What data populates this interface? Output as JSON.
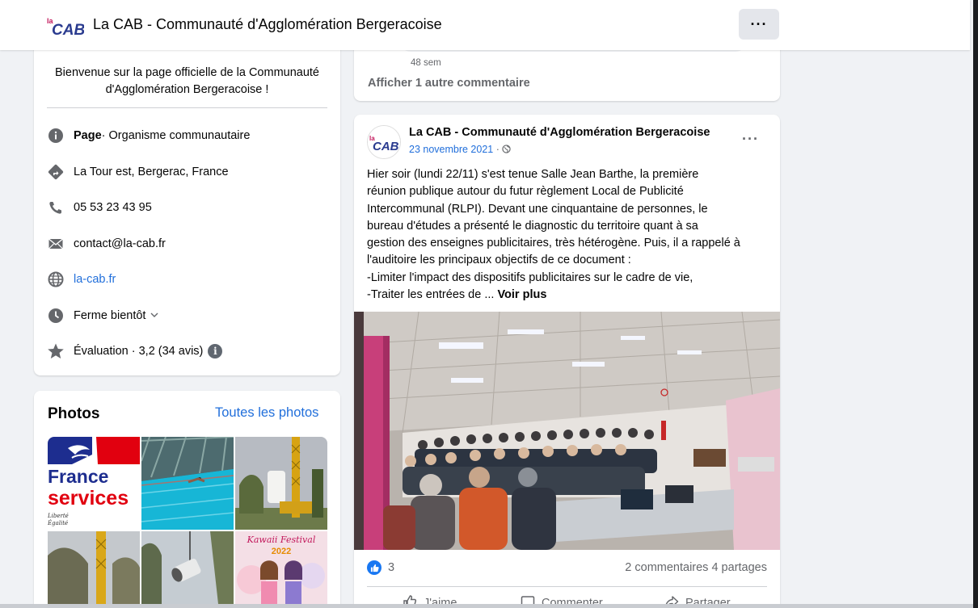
{
  "header": {
    "logo_text": "laCAB",
    "title": "La CAB - Communauté d'Agglomération Bergeracoise",
    "more_label": "···"
  },
  "intro": {
    "welcome": "Bienvenue sur la page officielle de la Communauté d'Agglomération Bergeracoise !",
    "category_label": "Page",
    "category_value": " · Organisme communautaire",
    "address": "La Tour est, Bergerac, France",
    "phone": "05 53 23 43 95",
    "email": "contact@la-cab.fr",
    "website": "la-cab.fr",
    "hours": "Ferme bientôt",
    "rating": "Évaluation · 3,2 (34 avis)",
    "icons": [
      "info-icon",
      "location-icon",
      "phone-icon",
      "email-icon",
      "globe-icon",
      "clock-icon",
      "star-icon"
    ]
  },
  "photos": {
    "title": "Photos",
    "see_all": "Toutes les photos",
    "france_services": {
      "line1": "France",
      "line2": "services",
      "motto1": "Liberté",
      "motto2": "Égalité"
    },
    "festival": {
      "title": "Kawaii Festival",
      "year": "2022"
    }
  },
  "comment": {
    "time": "48 sem",
    "more": "Afficher 1 autre commentaire"
  },
  "post": {
    "author": "La CAB - Communauté d'Agglomération Bergeracoise",
    "date": "23 novembre 2021",
    "date_sep": " · ",
    "lines": [
      "Hier soir (lundi 22/11) s'est tenue Salle Jean Barthe, la première",
      "réunion publique autour du futur règlement Local de Publicité",
      "Intercommunal (RLPI). Devant une cinquantaine de personnes, le",
      "bureau d'études a présenté le diagnostic du territoire quant à sa",
      "gestion des enseignes publicitaires, très hétérogène. Puis, il a rappelé à",
      "l'auditoire les principaux objectifs de ce document :",
      "-Limiter l'impact des dispositifs publicitaires sur le cadre de vie,"
    ],
    "last_line": "-Traiter les entrées de ... ",
    "see_more": "Voir plus",
    "reactions_count": "3",
    "comments": "2 commentaires",
    "shares": "4 partages",
    "actions": {
      "like": "J'aime",
      "comment": "Commenter",
      "share": "Partager"
    }
  },
  "colors": {
    "accent": "#216fdb",
    "like": "#1877f2",
    "page_bg": "#f0f2f5"
  }
}
